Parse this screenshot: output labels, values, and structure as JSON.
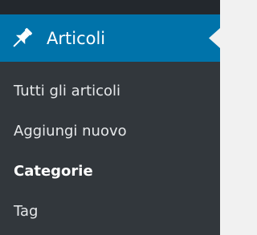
{
  "menu": {
    "icon": "pin-icon",
    "label": "Articoli",
    "items": [
      {
        "label": "Tutti gli articoli"
      },
      {
        "label": "Aggiungi nuovo"
      },
      {
        "label": "Categorie",
        "current": true
      },
      {
        "label": "Tag"
      }
    ]
  },
  "colors": {
    "sidebar": "#32373c",
    "active": "#0073aa",
    "content": "#f1f1f1"
  }
}
